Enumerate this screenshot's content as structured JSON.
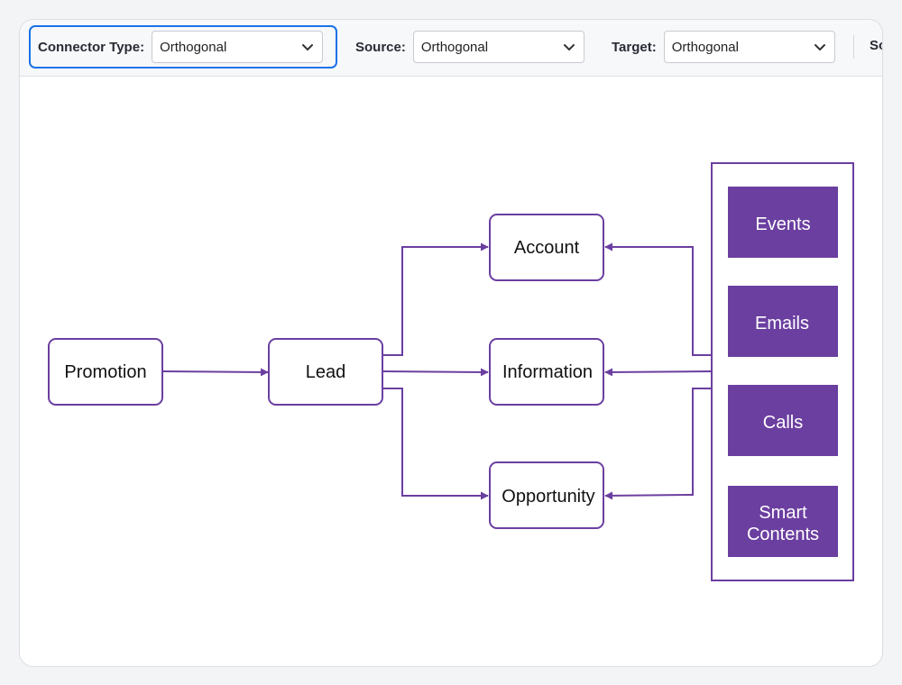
{
  "toolbar": {
    "connector_type": {
      "label": "Connector Type:",
      "value": "Orthogonal"
    },
    "source": {
      "label": "Source:",
      "value": "Orthogonal"
    },
    "target": {
      "label": "Target:",
      "value": "Orthogonal"
    },
    "truncated_label": "So"
  },
  "diagram": {
    "nodes": {
      "promotion": "Promotion",
      "lead": "Lead",
      "account": "Account",
      "information": "Information",
      "opportunity": "Opportunity"
    },
    "group": {
      "events": "Events",
      "emails": "Emails",
      "calls": "Calls",
      "smart_contents_line1": "Smart",
      "smart_contents_line2": "Contents"
    }
  },
  "colors": {
    "accent": "#6b3fa0",
    "focus": "#1a73e8",
    "node_fill": "#ffffff",
    "inner_fill": "#6b3fa0"
  },
  "icons": [
    "chevron-down-icon"
  ]
}
